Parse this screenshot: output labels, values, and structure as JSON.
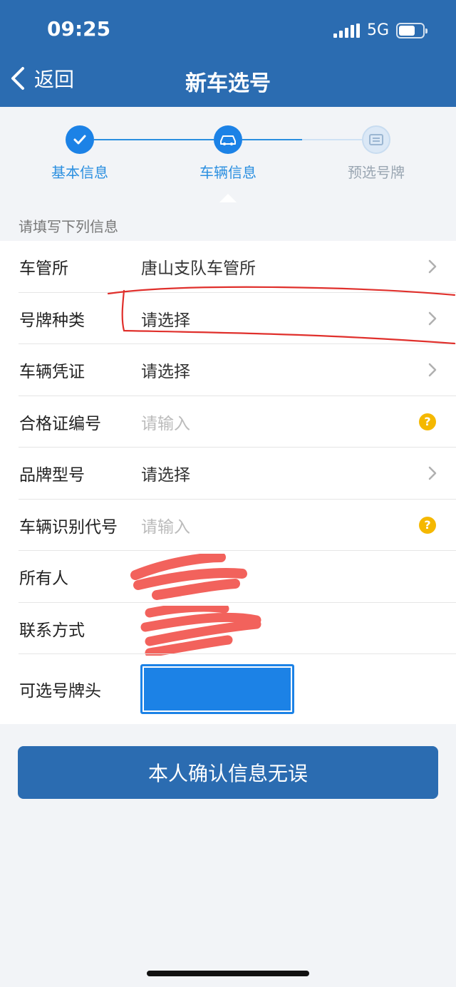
{
  "status_bar": {
    "time": "09:25",
    "network": "5G"
  },
  "nav": {
    "back_label": "返回",
    "title": "新车选号"
  },
  "steps": [
    {
      "label": "基本信息",
      "state": "done",
      "icon": "check-icon"
    },
    {
      "label": "车辆信息",
      "state": "active",
      "icon": "car-icon"
    },
    {
      "label": "预选号牌",
      "state": "pending",
      "icon": "plate-icon"
    }
  ],
  "form": {
    "hint": "请填写下列信息",
    "rows": [
      {
        "label": "车管所",
        "value": "唐山支队车管所"
      },
      {
        "label": "号牌种类",
        "value": "请选择"
      },
      {
        "label": "车辆凭证",
        "value": "请选择"
      },
      {
        "label": "合格证编号",
        "placeholder": "请输入"
      },
      {
        "label": "品牌型号",
        "value": "请选择"
      },
      {
        "label": "车辆识别代号",
        "placeholder": "请输入"
      },
      {
        "label": "所有人"
      },
      {
        "label": "联系方式"
      },
      {
        "label": "可选号牌头"
      }
    ]
  },
  "confirm_button": "本人确认信息无误",
  "colors": {
    "primary": "#2b6cb1",
    "step_active": "#1c82e6",
    "help_badge": "#f5b800",
    "annotation_red": "#e0302c"
  }
}
